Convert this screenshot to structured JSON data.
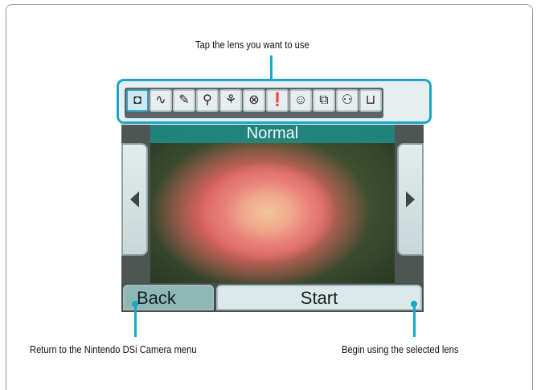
{
  "captions": {
    "top": "Tap the lens you want to use",
    "left": "Return to the Nintendo DSi Camera menu",
    "right": "Begin using the selected lens"
  },
  "lenses": [
    {
      "icon": "camera-icon",
      "glyph": "◘",
      "selected": true
    },
    {
      "icon": "wave-icon",
      "glyph": "∿"
    },
    {
      "icon": "pencil-icon",
      "glyph": "✎"
    },
    {
      "icon": "eyedropper-icon",
      "glyph": "⚲"
    },
    {
      "icon": "mirror-icon",
      "glyph": "⚘"
    },
    {
      "icon": "kaleidoscope-icon",
      "glyph": "⊗"
    },
    {
      "icon": "exclamation-face-icon",
      "glyph": "❗"
    },
    {
      "icon": "face-icon",
      "glyph": "☺"
    },
    {
      "icon": "double-face-icon",
      "glyph": "⧉"
    },
    {
      "icon": "pair-faces-icon",
      "glyph": "⚇"
    },
    {
      "icon": "frame-icon",
      "glyph": "⊔"
    }
  ],
  "screen": {
    "lens_name": "Normal",
    "back_label": "Back",
    "start_label": "Start"
  },
  "colors": {
    "accent": "#1aa6c6",
    "title_bar": "#1e8c87"
  }
}
